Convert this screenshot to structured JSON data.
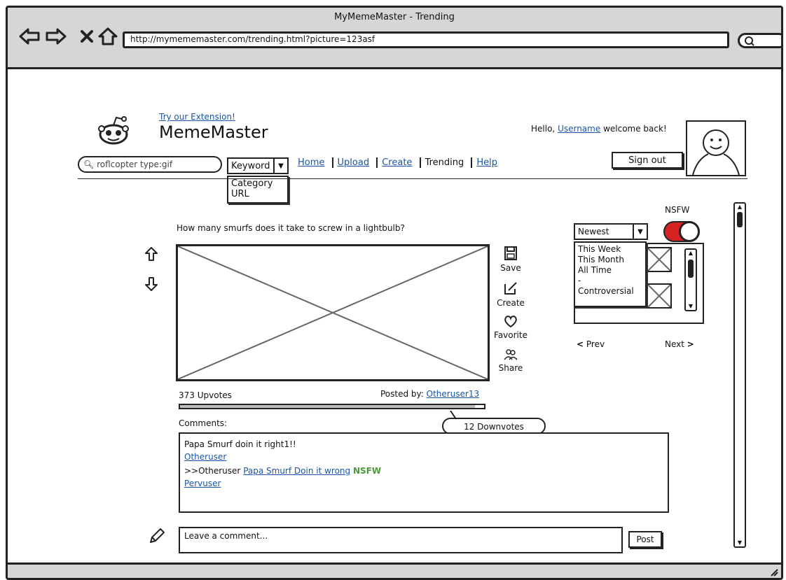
{
  "window": {
    "title": "MyMemeMaster - Trending",
    "url": "http://mymememaster.com/trending.html?picture=123asf"
  },
  "header": {
    "extension_link": "Try our Extension!",
    "brand": "MemeMaster",
    "greeting_prefix": "Hello,",
    "username": "Username",
    "greeting_suffix": "welcome back!",
    "signout": "Sign out"
  },
  "search": {
    "value": "roflcopter type:gif",
    "type_selected": "Keyword",
    "type_options": [
      "Category",
      "URL"
    ]
  },
  "nav": {
    "home": "Home",
    "upload": "Upload",
    "create": "Create",
    "trending": "Trending",
    "help": "Help"
  },
  "post": {
    "title": "How many smurfs does it take to screw in a lightbulb?",
    "upvotes": "373 Upvotes",
    "posted_by_label": "Posted by:",
    "posted_by_user": "Otheruser13",
    "downvotes": "12 Downvotes",
    "vote_ratio": 0.97
  },
  "actions": {
    "save": "Save",
    "create": "Create",
    "favorite": "Favorite",
    "share": "Share"
  },
  "comments": {
    "label": "Comments:",
    "c1_text": "Papa Smurf doin it right1!!",
    "c1_user": "Otheruser",
    "c2_prefix": ">>Otheruser",
    "c2_link": "Papa Smurf Doin it wrong",
    "c2_tag": "NSFW",
    "c2_user": "Pervuser",
    "input_placeholder": "Leave a comment...",
    "post_button": "Post"
  },
  "sidebar": {
    "nsfw_label": "NSFW",
    "nsfw_on": true,
    "sort_selected": "Newest",
    "sort_options": [
      "This Week",
      "This Month",
      "All Time",
      "-",
      "Controversial"
    ],
    "prev": "Prev",
    "next": "Next"
  }
}
